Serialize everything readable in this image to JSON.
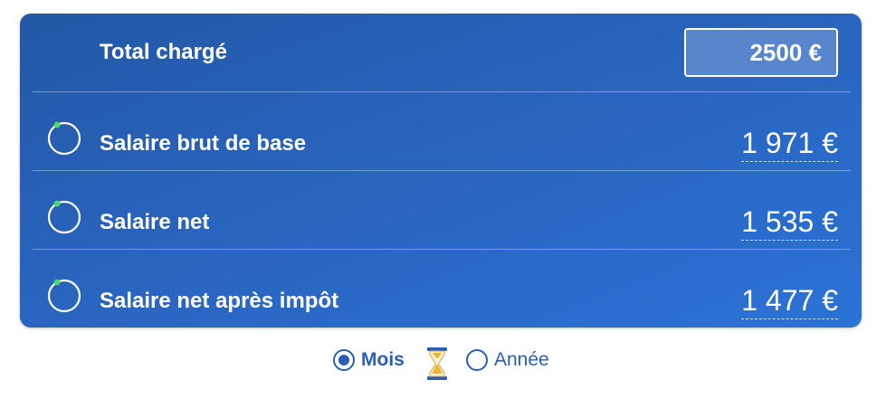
{
  "results": {
    "total": {
      "label": "Total chargé",
      "value": "2500 €"
    },
    "rows": [
      {
        "label": "Salaire brut de base",
        "value": "1 971 €"
      },
      {
        "label": "Salaire net",
        "value": "1 535 €"
      },
      {
        "label": "Salaire net après impôt",
        "value": "1 477 €"
      }
    ]
  },
  "period": {
    "options": [
      {
        "label": "Mois",
        "selected": true
      },
      {
        "label": "Année",
        "selected": false
      }
    ]
  },
  "colors": {
    "panel": "#2a66c2",
    "accent": "#2b5fb5",
    "indicator": "#4cd964"
  },
  "icons": {
    "row_indicator": "circle-progress-icon",
    "period_separator": "hourglass-icon"
  }
}
